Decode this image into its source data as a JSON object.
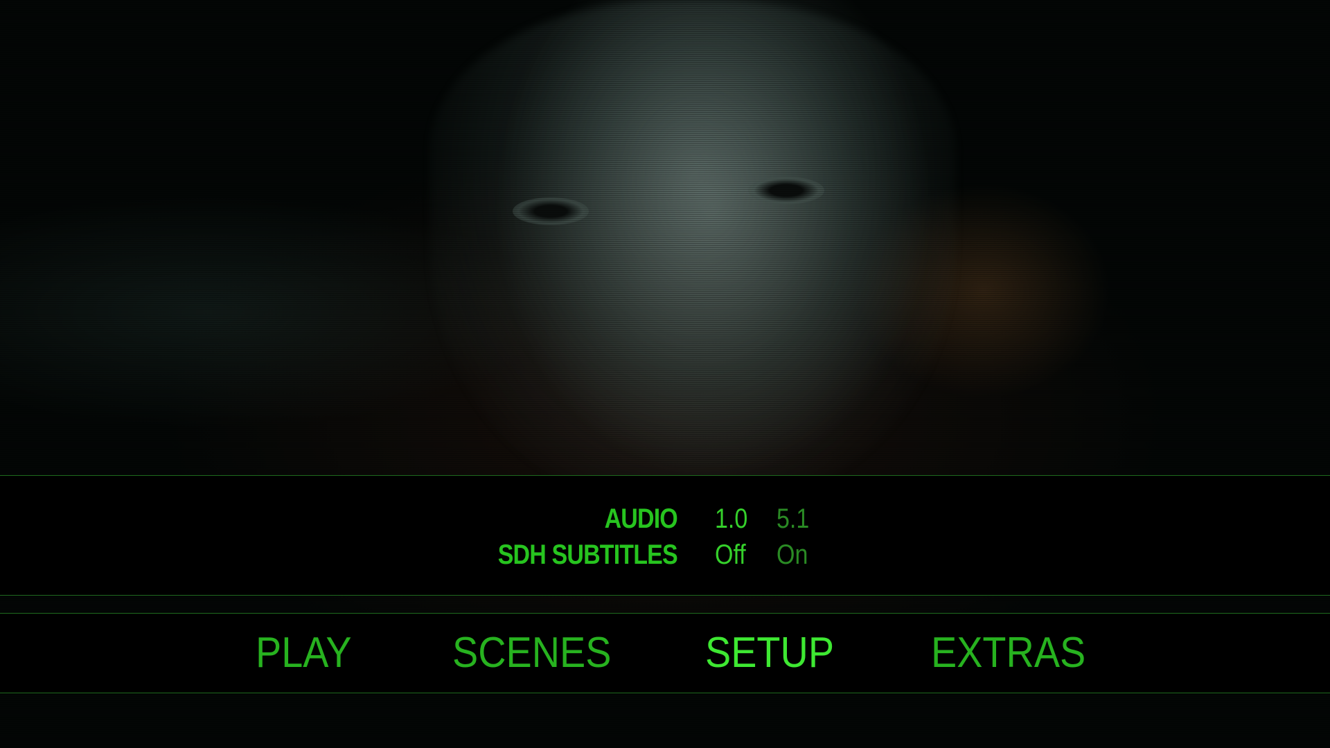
{
  "setup": {
    "rows": [
      {
        "label": "AUDIO",
        "options": [
          "1.0",
          "5.1"
        ],
        "selected": "1.0"
      },
      {
        "label": "SDH SUBTITLES",
        "options": [
          "Off",
          "On"
        ],
        "selected": "Off"
      }
    ]
  },
  "nav": {
    "items": [
      {
        "label": "PLAY"
      },
      {
        "label": "SCENES"
      },
      {
        "label": "SETUP"
      },
      {
        "label": "EXTRAS"
      }
    ],
    "active": "SETUP"
  },
  "colors": {
    "accent": "#27c41f",
    "active": "#3ee832",
    "inactive_option": "#2a8a24",
    "divider": "#1e6a1e",
    "background": "#000000"
  }
}
